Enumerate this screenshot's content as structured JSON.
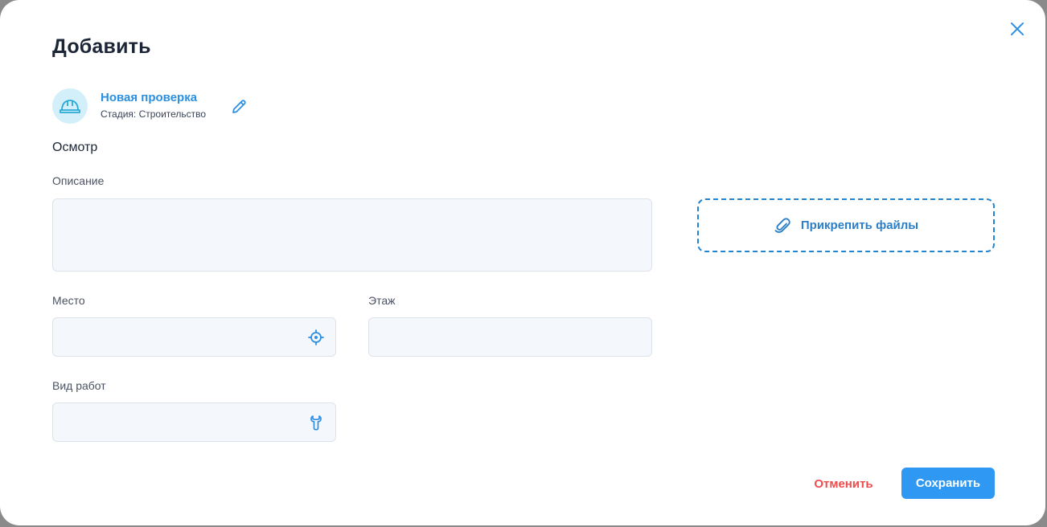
{
  "dialog": {
    "title": "Добавить"
  },
  "check": {
    "name": "Новая проверка",
    "stage": "Стадия: Строительство"
  },
  "section_title": "Осмотр",
  "fields": {
    "description": {
      "label": "Описание",
      "value": "",
      "placeholder": ""
    },
    "place": {
      "label": "Место",
      "value": "",
      "placeholder": ""
    },
    "floor": {
      "label": "Этаж",
      "value": "",
      "placeholder": ""
    },
    "work_type": {
      "label": "Вид работ",
      "value": "",
      "placeholder": ""
    }
  },
  "attach": {
    "label": "Прикрепить файлы"
  },
  "actions": {
    "cancel": "Отменить",
    "save": "Сохранить"
  },
  "icons": {
    "close": "close-icon",
    "helmet": "helmet-icon",
    "edit": "pencil-icon",
    "location": "crosshair-icon",
    "work": "wrench-icon",
    "attach": "paperclip-icon"
  },
  "colors": {
    "accent": "#2e98f2",
    "link": "#2b8fe0",
    "danger": "#ef4c4c",
    "title": "#1b2535",
    "field_bg": "#f4f7fb"
  }
}
